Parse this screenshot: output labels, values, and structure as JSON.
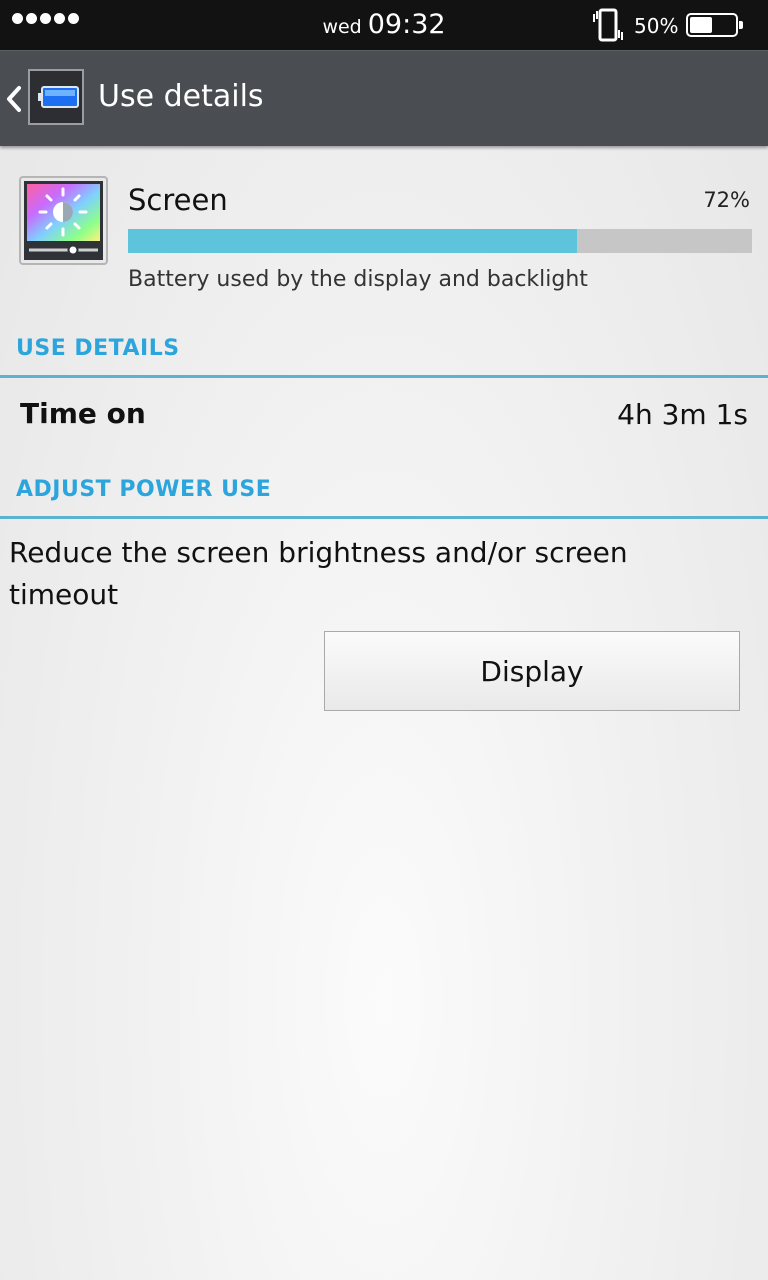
{
  "status_bar": {
    "day": "wed",
    "time": "09:32",
    "battery_percent_label": "50%",
    "battery_level": 0.5,
    "signal_icon": "signal-dots-icon",
    "vibrate_icon": "vibrate-icon",
    "battery_icon": "battery-icon"
  },
  "app_bar": {
    "title": "Use details",
    "back_icon": "back-chevron-icon",
    "app_icon": "battery-app-icon"
  },
  "usage_item": {
    "title": "Screen",
    "percent_label": "72%",
    "percent": 72,
    "description": "Battery used by the display and backlight",
    "icon": "screen-brightness-icon"
  },
  "use_details": {
    "header": "USE DETAILS",
    "rows": [
      {
        "label": "Time on",
        "value": "4h 3m 1s"
      }
    ]
  },
  "adjust_power": {
    "header": "ADJUST POWER USE",
    "tip": "Reduce the screen brightness and/or screen timeout",
    "button_label": "Display"
  },
  "colors": {
    "accent": "#2ba5dc",
    "progress_fill": "#5dc4dc",
    "app_bar": "#4a4d52",
    "status_bar": "#121212"
  }
}
